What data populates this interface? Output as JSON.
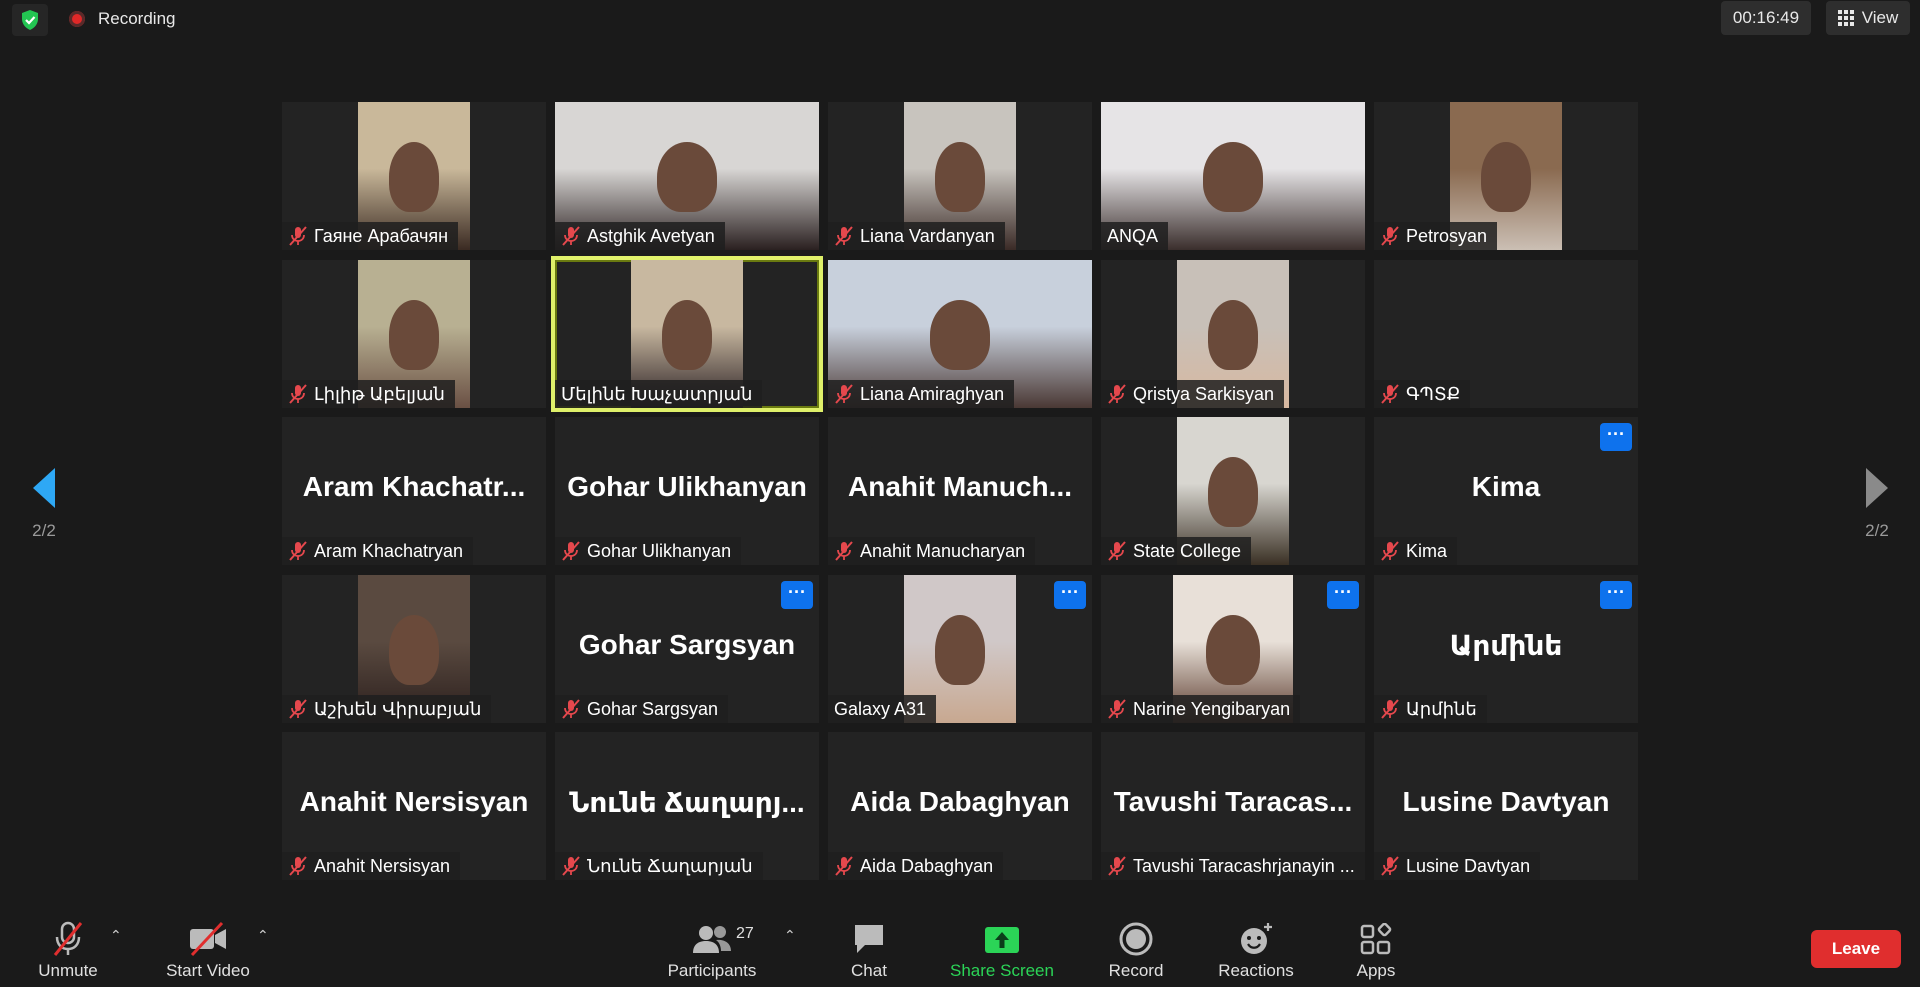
{
  "topbar": {
    "recording_label": "Recording",
    "timer": "00:16:49",
    "view_label": "View"
  },
  "nav": {
    "left_page": "2/2",
    "right_page": "2/2"
  },
  "tiles": [
    {
      "name": "Гаяне Арабачян",
      "muted": true,
      "video": true
    },
    {
      "name": "Astghik Avetyan",
      "muted": true,
      "video": true
    },
    {
      "name": "Liana  Vardanyan",
      "muted": true,
      "video": true
    },
    {
      "name": "ANQA",
      "muted": false,
      "video": true
    },
    {
      "name": "Petrosyan",
      "muted": true,
      "video": true
    },
    {
      "name": "Լիլիթ Աբելյան",
      "muted": true,
      "video": true
    },
    {
      "name": "Մելինե Խաչատրյան",
      "muted": false,
      "video": true,
      "active": true
    },
    {
      "name": "Liana Amiraghyan",
      "muted": true,
      "video": true
    },
    {
      "name": "Qristya Sarkisyan",
      "muted": true,
      "video": true
    },
    {
      "name": "ԳՊՏՔ",
      "muted": true,
      "video": false,
      "display": ""
    },
    {
      "name": "Aram Khachatryan",
      "muted": true,
      "video": false,
      "display": "Aram  Khachatr..."
    },
    {
      "name": "Gohar Ulikhanyan",
      "muted": true,
      "video": false,
      "display": "Gohar Ulikhanyan"
    },
    {
      "name": "Anahit Manucharyan",
      "muted": true,
      "video": false,
      "display": "Anahit  Manuch..."
    },
    {
      "name": "State College",
      "muted": true,
      "video": true
    },
    {
      "name": "Kima",
      "muted": true,
      "video": false,
      "display": "Kima",
      "menu": true
    },
    {
      "name": "Աշխեն Վիրաբյան",
      "muted": true,
      "video": true
    },
    {
      "name": "Gohar Sargsyan",
      "muted": true,
      "video": false,
      "display": "Gohar Sargsyan",
      "menu": true
    },
    {
      "name": "Galaxy A31",
      "muted": false,
      "video": true,
      "menu": true
    },
    {
      "name": "Narine Yengibaryan",
      "muted": true,
      "video": true,
      "menu": true
    },
    {
      "name": "Արմինե",
      "muted": true,
      "video": false,
      "display": "Արմինե",
      "menu": true
    },
    {
      "name": "Anahit Nersisyan",
      "muted": true,
      "video": false,
      "display": "Anahit Nersisyan"
    },
    {
      "name": "Նունե Ճաղարյան",
      "muted": true,
      "video": false,
      "display": "Նունե  Ճաղարյ..."
    },
    {
      "name": "Aida Dabaghyan",
      "muted": true,
      "video": false,
      "display": "Aida Dabaghyan"
    },
    {
      "name": "Tavushi Taracashrjanayin ...",
      "muted": true,
      "video": false,
      "display": "Tavushi  Taracas..."
    },
    {
      "name": "Lusine Davtyan",
      "muted": true,
      "video": false,
      "display": "Lusine Davtyan"
    }
  ],
  "toolbar": {
    "unmute": "Unmute",
    "start_video": "Start Video",
    "participants": "Participants",
    "participants_count": "27",
    "chat": "Chat",
    "share_screen": "Share Screen",
    "record": "Record",
    "reactions": "Reactions",
    "apps": "Apps",
    "leave": "Leave"
  },
  "colors": {
    "background": "#1a1a1a",
    "tile": "#232323",
    "accent_blue": "#0e72ed",
    "share_green": "#2bd457",
    "leave_red": "#e02e2e",
    "active_speaker": "#dff06a",
    "nav_arrow": "#2ea8f5"
  }
}
